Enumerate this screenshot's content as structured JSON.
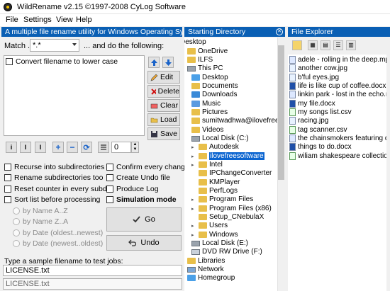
{
  "window": {
    "title": "WildRename v2.15 ©1997-2008 CyLog Software"
  },
  "menu": [
    "File",
    "Settings",
    "View",
    "Help"
  ],
  "left": {
    "header": "A multiple file rename utility for Windows Operating Systems",
    "match_label": "Match ...",
    "match_value": "*.*",
    "match_suffix": "... and do the following:",
    "rules": [
      "Convert filename to lower case"
    ],
    "buttons": {
      "edit": "Edit",
      "delete": "Delete",
      "clear": "Clear",
      "load": "Load",
      "save": "Save"
    },
    "icon_buttons": [
      "i",
      "I",
      "I",
      "+",
      "−",
      "⟳"
    ],
    "counter_value": "0",
    "options_left": [
      "Recurse into subdirectories",
      "Rename subdirectories too",
      "Reset counter in every subdir",
      "Sort list before processing"
    ],
    "options_right": [
      "Confirm every change",
      "Create Undo file",
      "Produce Log",
      "Simulation mode"
    ],
    "sort_options": [
      "by Name A..Z",
      "by Name Z..A",
      "by Date (oldest..newest)",
      "by Date (newest..oldest)"
    ],
    "go_label": "Go",
    "undo_label": "Undo",
    "sample_label": "Type a sample filename to test jobs:",
    "sample_input": "LICENSE.txt",
    "sample_output": "LICENSE.txt"
  },
  "directory": {
    "header": "Starting Directory",
    "nodes": [
      "Desktop",
      "OneDrive",
      "ILFS",
      "This PC",
      "Desktop",
      "Documents",
      "Downloads",
      "Music",
      "Pictures",
      "sumitwadhwa@ilovefreesoftware",
      "Videos",
      "Local Disk (C:)",
      "Autodesk",
      "ilovefreesoftware",
      "Intel",
      "IPChangeConverter",
      "KMPlayer",
      "PerfLogs",
      "Program Files",
      "Program Files (x86)",
      "Setup_CNebulaX",
      "Users",
      "Windows",
      "Local Disk (E:)",
      "DVD RW Drive (F:)",
      "Libraries",
      "Network",
      "Homegroup"
    ]
  },
  "explorer": {
    "header": "File Explorer",
    "files": [
      "adele - rolling in the deep.mp3",
      "another cow.jpg",
      "b'ful eyes.jpg",
      "life is like cup of coffee.docx",
      "linkin park - lost in the echo.mp3",
      "my file.docx",
      "my songs list.csv",
      "racing.jpg",
      "tag scanner.csv",
      "the chainsmokers featuring daya - don't let me down.mp3",
      "things to do.docx",
      "wiliam shakespeare collection.csv"
    ]
  }
}
